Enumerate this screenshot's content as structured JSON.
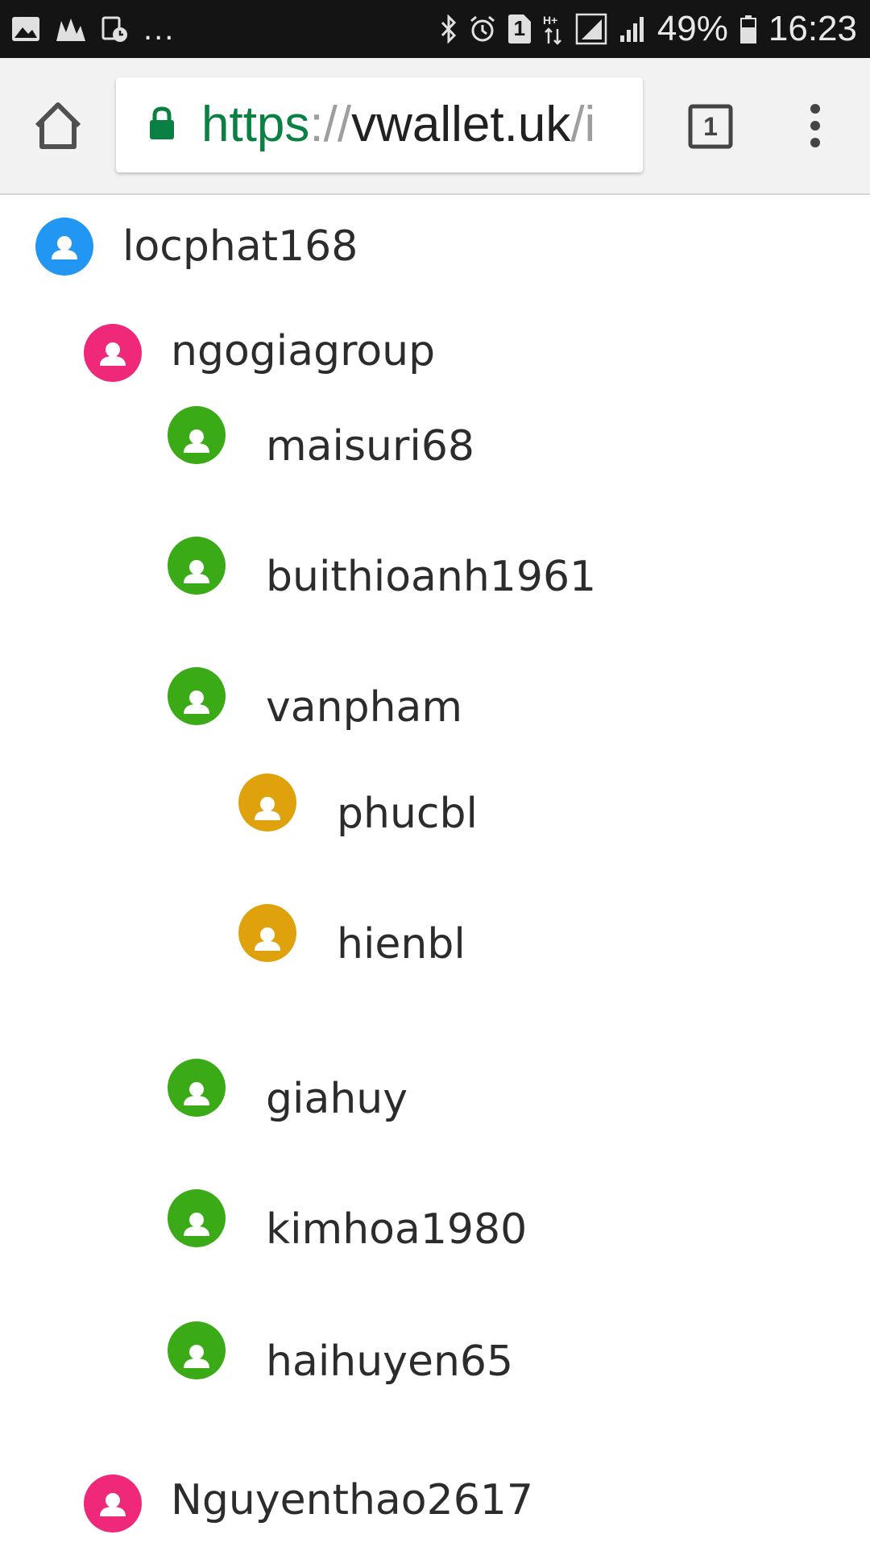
{
  "status_bar": {
    "overflow_dots": "...",
    "battery_percent": "49%",
    "time": "16:23",
    "data_badge": "1",
    "icons": [
      "image-icon",
      "stocks-icon",
      "calendar-clock-icon",
      "bluetooth-icon",
      "alarm-icon",
      "sim-icon",
      "data-arrows-icon",
      "signal-icon",
      "signal-icon",
      "battery-icon"
    ]
  },
  "toolbar": {
    "url_scheme": "https",
    "url_sep": "://",
    "url_host": "vwallet.uk",
    "url_path": "/i",
    "tab_count": "1",
    "icons": [
      "home-icon",
      "lock-icon",
      "tabs-icon",
      "more-vert-icon"
    ]
  },
  "colors": {
    "root": "#2196f3",
    "level1": "#f0287a",
    "level2": "#3aaa16",
    "level3": "#e0a20c",
    "lock": "#0b8043"
  },
  "tree": [
    {
      "name": "locphat168",
      "level": "root"
    },
    {
      "name": "ngogiagroup",
      "level": "level1"
    },
    {
      "name": "maisuri68",
      "level": "level2"
    },
    {
      "name": "buithioanh1961",
      "level": "level2"
    },
    {
      "name": "vanpham",
      "level": "level2"
    },
    {
      "name": "phucbl",
      "level": "level3"
    },
    {
      "name": "hienbl",
      "level": "level3"
    },
    {
      "name": "giahuy",
      "level": "level2"
    },
    {
      "name": "kimhoa1980",
      "level": "level2"
    },
    {
      "name": "haihuyen65",
      "level": "level2"
    },
    {
      "name": "Nguyenthao2617",
      "level": "level1"
    }
  ]
}
